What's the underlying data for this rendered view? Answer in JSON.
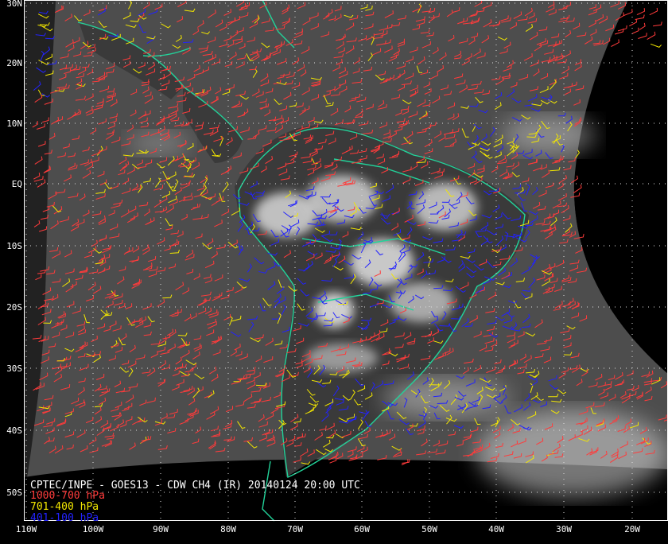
{
  "map": {
    "lat_labels": [
      "30N",
      "20N",
      "10N",
      "EQ",
      "10S",
      "20S",
      "30S",
      "40S",
      "50S"
    ],
    "lon_labels": [
      "110W",
      "100W",
      "90W",
      "80W",
      "70W",
      "60W",
      "50W",
      "40W",
      "30W",
      "20W"
    ],
    "title": "CPTEC/INPE - GOES13 - CDW CH4 (IR) 20140124 20:00 UTC",
    "legend": [
      {
        "label": "1000-700 hPa",
        "color": "#ff3b3b"
      },
      {
        "label": "701-400 hPa",
        "color": "#f2e600"
      },
      {
        "label": "401-100 hPa",
        "color": "#2222ff"
      }
    ],
    "coastline_color": "#22d39a"
  }
}
